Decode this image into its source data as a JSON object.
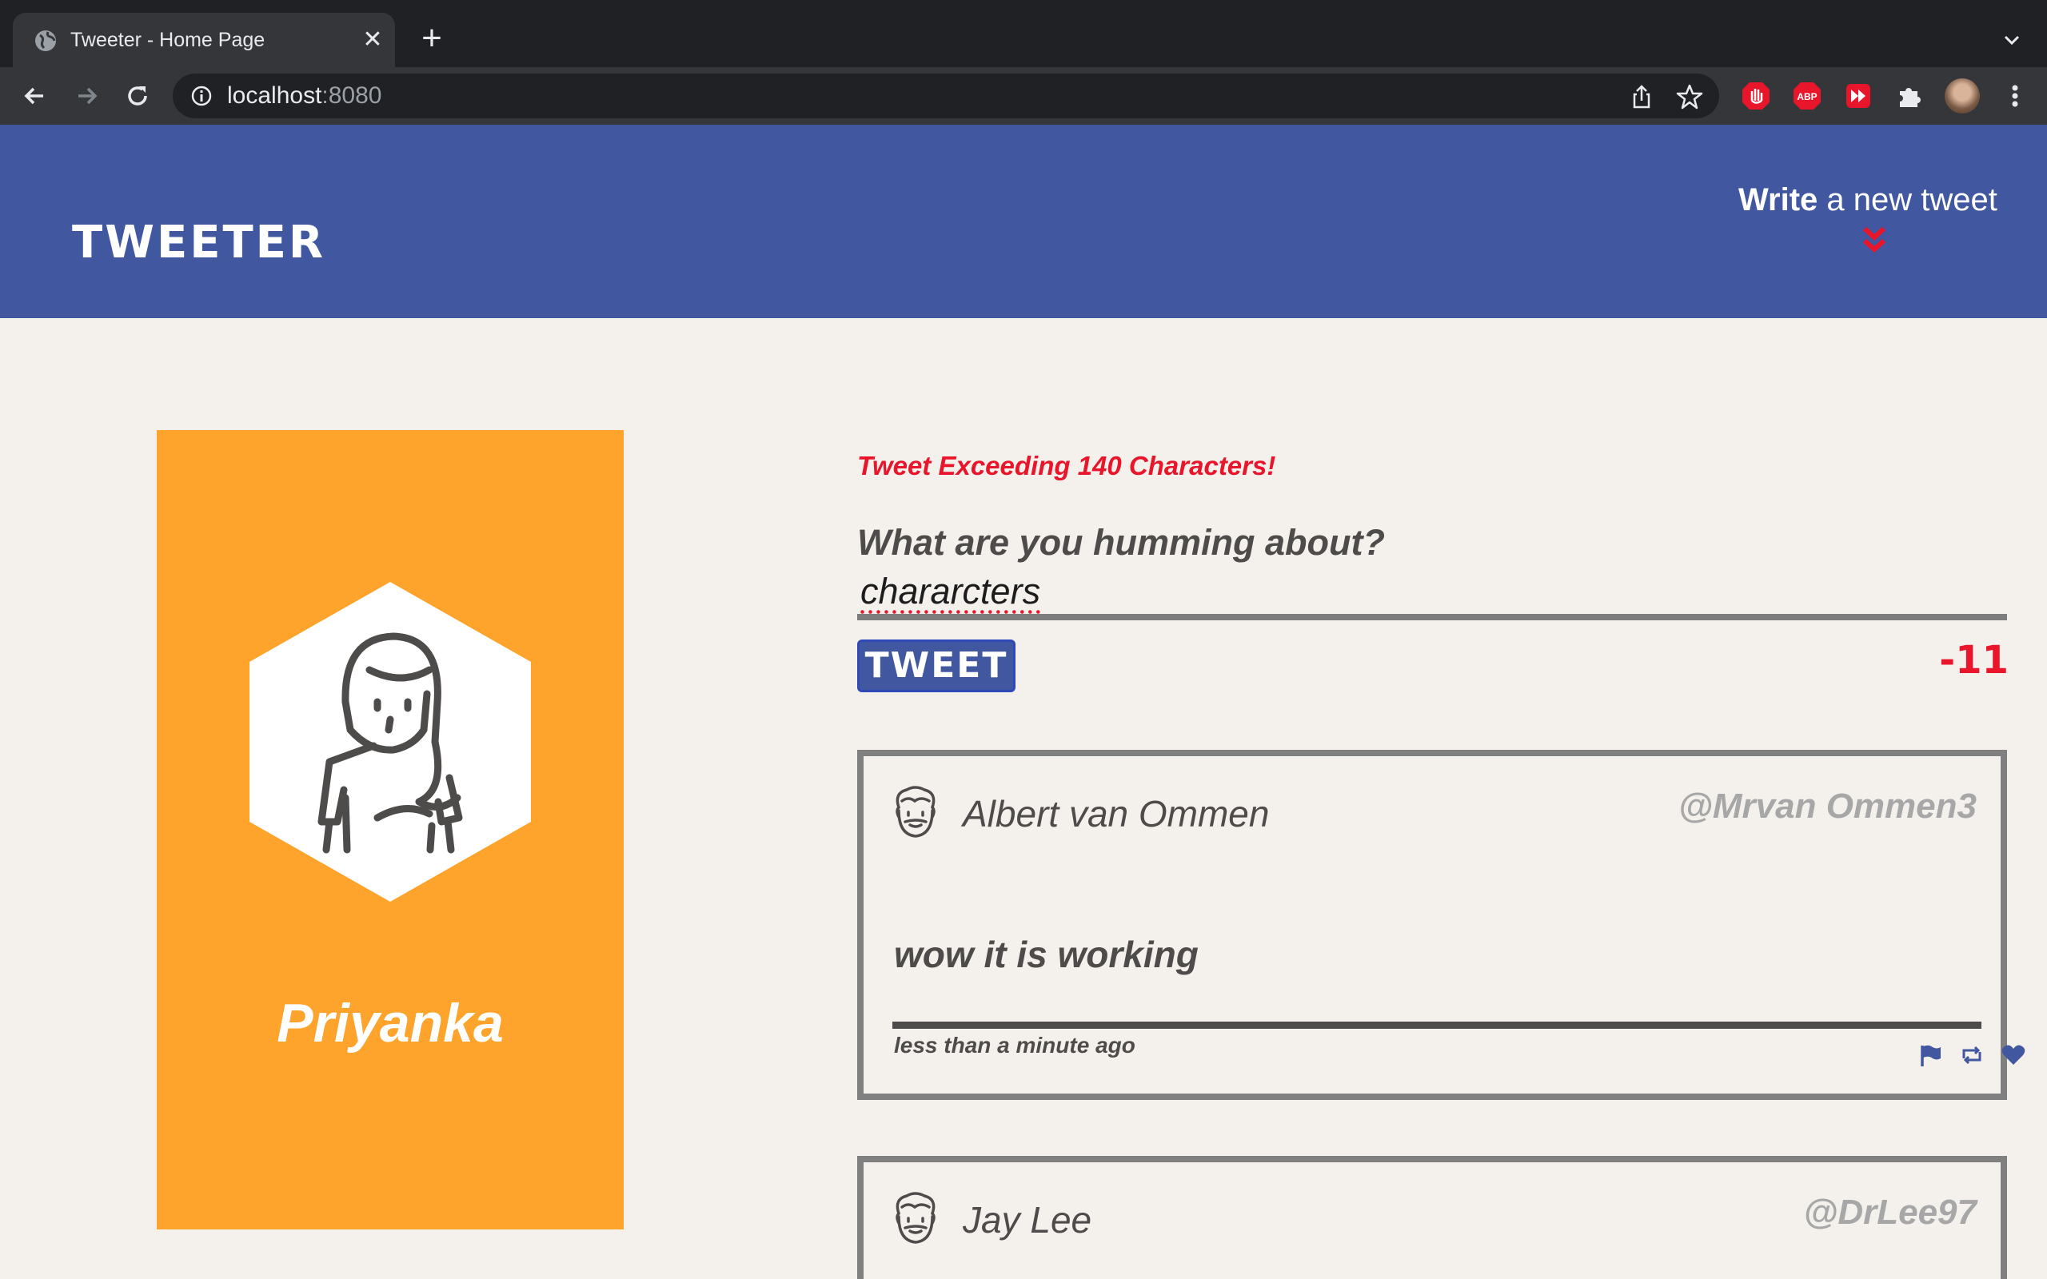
{
  "browser": {
    "tab_title": "Tweeter - Home Page",
    "tab_close": "✕",
    "new_tab": "+",
    "url_host": "localhost",
    "url_port": ":8080",
    "extensions": [
      "stop-ext-icon",
      "adblock-plus-icon",
      "media-ext-icon",
      "puzzle-icon"
    ]
  },
  "header": {
    "brand": "TWEETER",
    "write_bold": "Write",
    "write_rest": " a new tweet",
    "accent_color": "#4158a0"
  },
  "profile": {
    "name": "Priyanka",
    "card_color": "#fea32b"
  },
  "compose": {
    "error": "Tweet Exceeding 140 Characters!",
    "prompt": "What are you humming about?",
    "input_value": "chararcters",
    "button_label": "TWEET",
    "counter": "-11",
    "error_color": "#e8152b"
  },
  "tweets": [
    {
      "name": "Albert van Ommen",
      "handle": "@Mrvan Ommen3",
      "content": "wow it is working",
      "time": "less than a minute ago"
    },
    {
      "name": "Jay Lee",
      "handle": "@DrLee97"
    }
  ]
}
